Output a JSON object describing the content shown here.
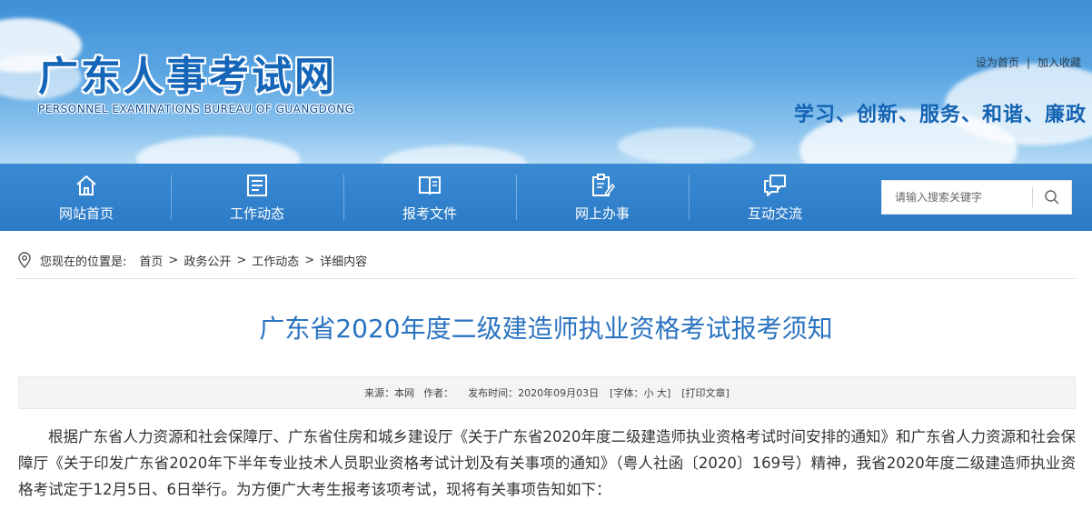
{
  "header": {
    "logo_cn": "广东人事考试网",
    "logo_en": "PERSONNEL EXAMINATIONS BUREAU OF GUANGDONG",
    "toplinks": {
      "homepage": "设为首页",
      "separator": "|",
      "favorite": "加入收藏"
    },
    "slogan": "学习、创新、服务、和谐、廉政"
  },
  "nav": {
    "items": [
      {
        "label": "网站首页",
        "icon": "home-icon"
      },
      {
        "label": "工作动态",
        "icon": "news-list-icon"
      },
      {
        "label": "报考文件",
        "icon": "book-icon"
      },
      {
        "label": "网上办事",
        "icon": "clipboard-edit-icon"
      },
      {
        "label": "互动交流",
        "icon": "chat-bubbles-icon"
      }
    ],
    "search": {
      "placeholder": "请输入搜索关键字",
      "value": "",
      "icon": "search-icon"
    }
  },
  "breadcrumb": {
    "icon": "location-pin-icon",
    "prefix": "您现在的位置是:",
    "items": [
      "首页",
      "政务公开",
      "工作动态",
      "详细内容"
    ],
    "separator": ">"
  },
  "article": {
    "title": "广东省2020年度二级建造师执业资格考试报考须知",
    "meta": {
      "source": "来源：本网",
      "author": "作者：",
      "published": "发布时间：2020年09月03日",
      "font": "[字体：小 大]",
      "print": "[打印文章]"
    },
    "body": "根据广东省人力资源和社会保障厅、广东省住房和城乡建设厅《关于广东省2020年度二级建造师执业资格考试时间安排的通知》和广东省人力资源和社会保障厅《关于印发广东省2020年下半年专业技术人员职业资格考试计划及有关事项的通知》（粤人社函〔2020〕169号）精神，我省2020年度二级建造师执业资格考试定于12月5日、6日举行。为方便广大考生报考该项考试，现将有关事项告知如下："
  },
  "colors": {
    "nav_bg": "#2b7ac6",
    "title": "#2a73c0",
    "slogan": "#1463b3",
    "logo": "#1565b8"
  }
}
